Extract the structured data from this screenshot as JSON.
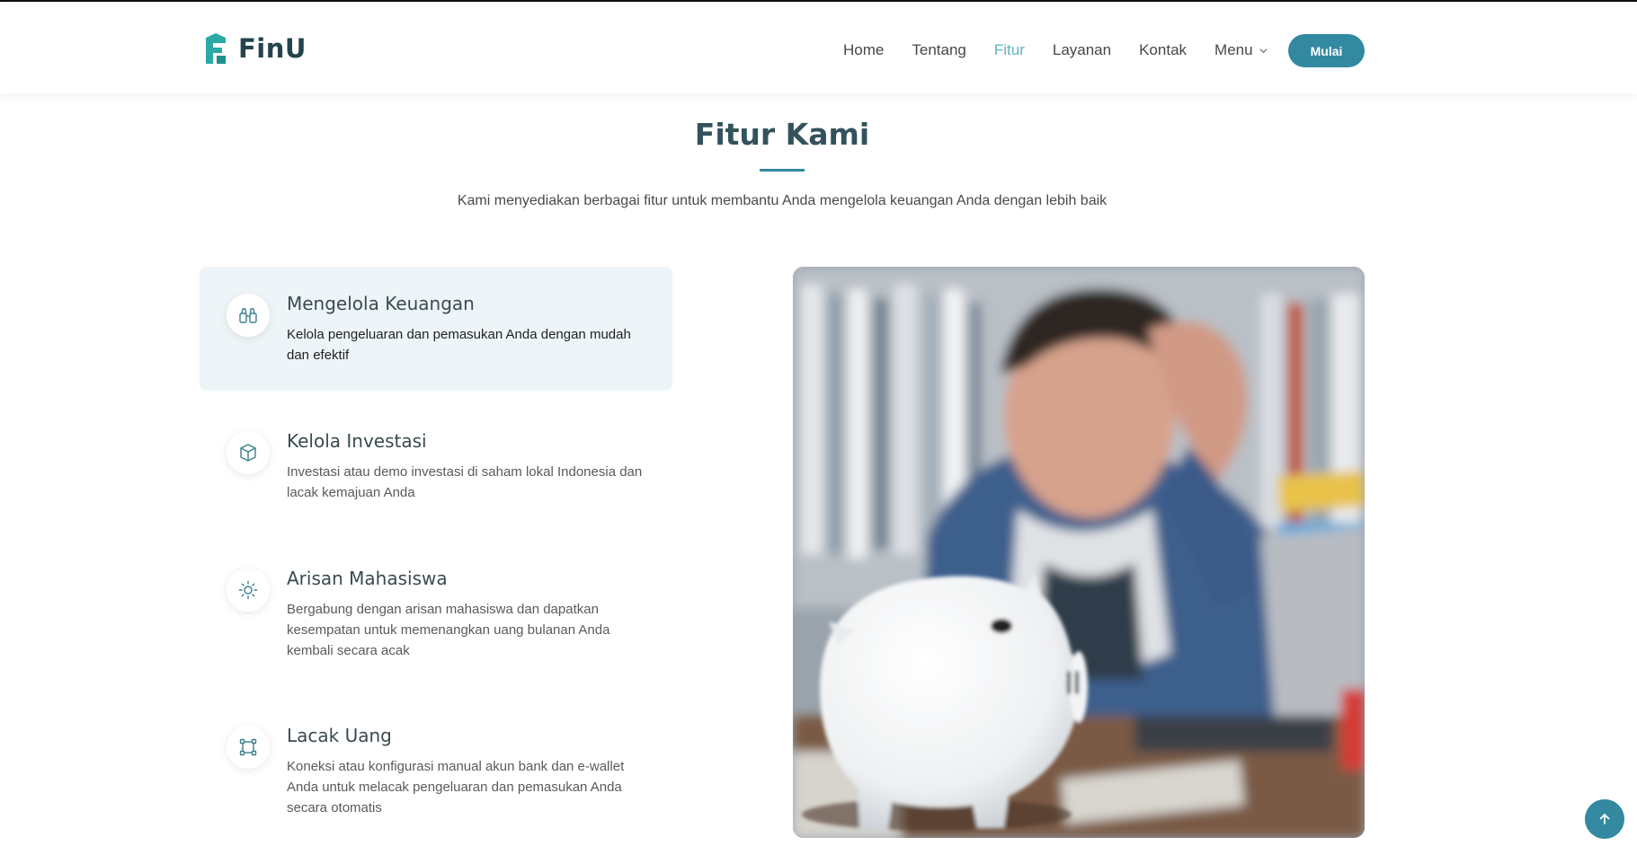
{
  "brand": {
    "name": "FinU",
    "logo_icon": "finu-logo-icon"
  },
  "nav": {
    "items": [
      {
        "label": "Home",
        "active": false
      },
      {
        "label": "Tentang",
        "active": false
      },
      {
        "label": "Fitur",
        "active": true
      },
      {
        "label": "Layanan",
        "active": false
      },
      {
        "label": "Kontak",
        "active": false
      }
    ],
    "menu_label": "Menu",
    "menu_icon": "chevron-down-icon",
    "cta_label": "Mulai"
  },
  "section": {
    "title": "Fitur Kami",
    "subtitle": "Kami menyediakan berbagai fitur untuk membantu Anda mengelola keuangan Anda dengan lebih baik"
  },
  "features": [
    {
      "title": "Mengelola Keuangan",
      "description": "Kelola pengeluaran dan pemasukan Anda dengan mudah dan efektif",
      "icon": "binoculars-icon",
      "active": true
    },
    {
      "title": "Kelola Investasi",
      "description": "Investasi atau demo investasi di saham lokal Indonesia dan lacak kemajuan Anda",
      "icon": "box-icon",
      "active": false
    },
    {
      "title": "Arisan Mahasiswa",
      "description": "Bergabung dengan arisan mahasiswa dan dapatkan kesempatan untuk memenangkan uang bulanan Anda kembali secara acak",
      "icon": "sun-icon",
      "active": false
    },
    {
      "title": "Lacak Uang",
      "description": "Koneksi atau konfigurasi manual akun bank dan e-wallet Anda untuk melacak pengeluaran dan pemasukan Anda secara otomatis",
      "icon": "bounding-box-icon",
      "active": false
    }
  ],
  "image": {
    "subject": "stressed student with piggy bank"
  },
  "back_to_top": {
    "icon": "arrow-up-icon"
  },
  "colors": {
    "accent": "#3289a0",
    "nav_active": "#5fb3c2",
    "heading": "#33525c",
    "active_card_bg": "#eef5f8"
  }
}
